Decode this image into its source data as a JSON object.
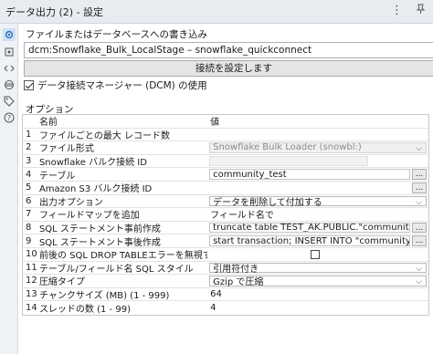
{
  "window": {
    "title": "データ出力 (2) - 設定"
  },
  "titlebar_icons": [
    "more-vertical-icon",
    "pin-icon"
  ],
  "left_rail": [
    "gear-icon",
    "node-icon",
    "code-icon",
    "link-icon",
    "tag-icon",
    "help-icon"
  ],
  "connection": {
    "label": "ファイルまたはデータベースへの書き込み",
    "value": "dcm:Snowflake_Bulk_LocalStage – snowflake_quickconnect",
    "button_label": "接続を設定します"
  },
  "dcm": {
    "label": "データ接続マネージャー (DCM) の使用",
    "checked": true
  },
  "options": {
    "label": "オプション",
    "header": {
      "name": "名前",
      "value": "値"
    },
    "rows": [
      {
        "num": "1",
        "name": "ファイルごとの最大 レコード数",
        "value": ""
      },
      {
        "num": "2",
        "name": "ファイル形式",
        "value": "Snowflake Bulk Loader (snowbl:)"
      },
      {
        "num": "3",
        "name": "Snowflake バルク接続 ID",
        "value": ""
      },
      {
        "num": "4",
        "name": "テーブル",
        "value": "community_test"
      },
      {
        "num": "5",
        "name": "Amazon S3 バルク接続 ID",
        "value": ""
      },
      {
        "num": "6",
        "name": "出力オプション",
        "value": "データを削除して付加する"
      },
      {
        "num": "7",
        "name": "フィールドマップを追加",
        "value": "フィールド名で"
      },
      {
        "num": "8",
        "name": "SQL ステートメント事前作成",
        "value": "truncate  table  TEST_AK.PUBLIC.\"community_tes..."
      },
      {
        "num": "9",
        "name": "SQL ステートメント事後作成",
        "value": "start transaction; INSERT INTO \"community_test\"..."
      },
      {
        "num": "10",
        "name": "前後の SQL DROP TABLEエラーを無視する",
        "value": ""
      },
      {
        "num": "11",
        "name": "テーブル/フィールド名 SQL スタイル",
        "value": "引用符付き"
      },
      {
        "num": "12",
        "name": "圧縮タイプ",
        "value": "Gzip で圧縮"
      },
      {
        "num": "13",
        "name": "チャンクサイズ (MB) (1 - 999)",
        "value": "64"
      },
      {
        "num": "14",
        "name": "スレッドの数 (1 - 99)",
        "value": "4"
      }
    ],
    "ellipsis": "..."
  }
}
